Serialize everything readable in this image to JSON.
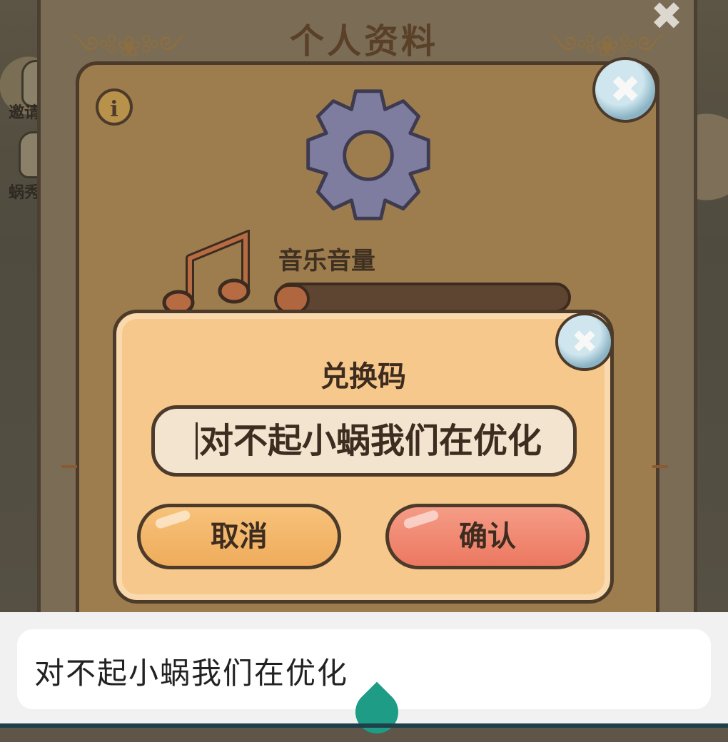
{
  "background": {
    "side_labels": [
      "邀请",
      "蜗秀"
    ]
  },
  "profile_panel": {
    "title": "个人资料",
    "music_label": "音乐音量",
    "music_volume_fraction": 0.05
  },
  "redeem_dialog": {
    "title": "兑换码",
    "input_value": "对不起小蜗我们在优化",
    "cancel_label": "取消",
    "confirm_label": "确认"
  },
  "ime": {
    "candidate_text": "对不起小蜗我们在优化"
  },
  "icons": [
    "close-icon",
    "info-icon",
    "gear-icon",
    "music-note-icon"
  ],
  "colors": {
    "dialog_bg": "#f6c88b",
    "cancel": "#efac5c",
    "confirm": "#ec7861",
    "outline": "#4c3a2a",
    "ime_handle": "#1e9c86"
  }
}
